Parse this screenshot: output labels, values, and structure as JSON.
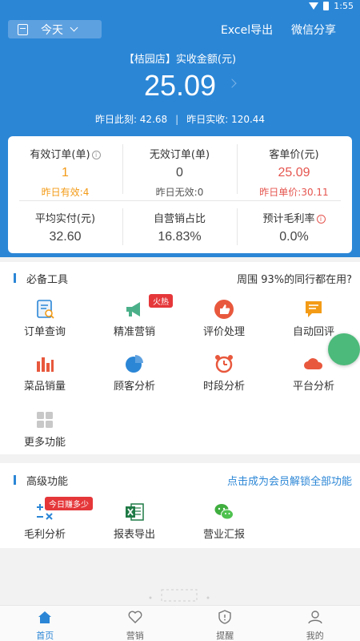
{
  "status": {
    "time": "1:55"
  },
  "header": {
    "date_label": "今天",
    "excel_export": "Excel导出",
    "wechat_share": "微信分享"
  },
  "summary": {
    "store_title": "【桔园店】实收金额(元)",
    "amount": "25.09",
    "yesterday_same_time": "昨日此刻: 42.68",
    "separator": "|",
    "yesterday_actual": "昨日实收: 120.44"
  },
  "stats": [
    {
      "label": "有效订单(单)",
      "value": "1",
      "sub": "昨日有效:4"
    },
    {
      "label": "无效订单(单)",
      "value": "0",
      "sub": "昨日无效:0"
    },
    {
      "label": "客单价(元)",
      "value": "25.09",
      "sub": "昨日单价:30.11"
    },
    {
      "label": "平均实付(元)",
      "value": "32.60"
    },
    {
      "label": "自营销占比",
      "value": "16.83%"
    },
    {
      "label": "预计毛利率",
      "value": "0.0%"
    }
  ],
  "info_glyph": "i",
  "tools_section": {
    "title": "必备工具",
    "right_text": "周围 93%的同行都在用?",
    "items": [
      {
        "name": "订单查询",
        "icon": "order-search-icon"
      },
      {
        "name": "精准营销",
        "icon": "marketing-horn-icon",
        "badge": "火热"
      },
      {
        "name": "评价处理",
        "icon": "thumbs-up-icon"
      },
      {
        "name": "自动回评",
        "icon": "auto-reply-icon"
      },
      {
        "name": "菜品销量",
        "icon": "bar-chart-icon"
      },
      {
        "name": "顾客分析",
        "icon": "pie-chart-icon"
      },
      {
        "name": "时段分析",
        "icon": "alarm-clock-icon"
      },
      {
        "name": "平台分析",
        "icon": "cloud-icon"
      },
      {
        "name": "更多功能",
        "icon": "grid-icon"
      }
    ]
  },
  "advanced_section": {
    "title": "高级功能",
    "right_text": "点击成为会员解锁全部功能",
    "items": [
      {
        "name": "毛利分析",
        "icon": "calculator-icon",
        "badge": "今日赚多少"
      },
      {
        "name": "报表导出",
        "icon": "excel-icon"
      },
      {
        "name": "营业汇报",
        "icon": "wechat-icon"
      }
    ]
  },
  "tabbar": [
    {
      "label": "首页",
      "icon": "home-icon",
      "active": true
    },
    {
      "label": "营销",
      "icon": "heart-icon"
    },
    {
      "label": "提醒",
      "icon": "shield-bell-icon"
    },
    {
      "label": "我的",
      "icon": "user-icon"
    }
  ],
  "colors": {
    "primary_blue": "#2b86d6",
    "orange": "#f39b17",
    "red": "#e5554f",
    "green_fab": "#4cba7a"
  }
}
